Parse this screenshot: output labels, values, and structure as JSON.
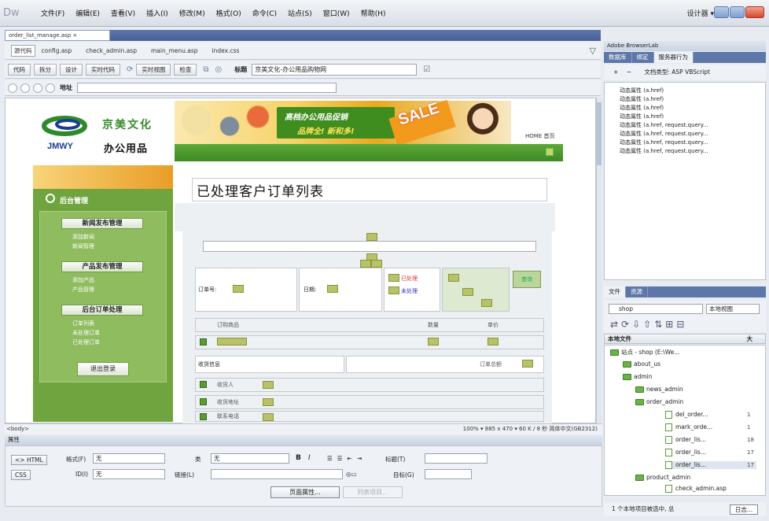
{
  "app": {
    "menus": [
      "文件(F)",
      "编辑(E)",
      "查看(V)",
      "插入(I)",
      "修改(M)",
      "格式(O)",
      "命令(C)",
      "站点(S)",
      "窗口(W)",
      "帮助(H)"
    ],
    "workspace": "设计器 ▾"
  },
  "document": {
    "tab": "order_list_manage.asp ×",
    "related_files": [
      "源代码",
      "config.asp",
      "check_admin.asp",
      "main_menu.asp",
      "index.css"
    ],
    "toolbar": {
      "code": "代码",
      "split": "拆分",
      "design": "设计",
      "live_code": "实时代码",
      "live_view": "实时视图",
      "inspect": "检查",
      "title_label": "标题",
      "title_value": "京美文化-办公用品购物网"
    },
    "address_label": "地址"
  },
  "page": {
    "brand_cn": "京美文化",
    "brand_en": "JMWY",
    "brand_sub": "办公用品",
    "banner_line1": "高档办公用品促销",
    "banner_line2": "品牌全! 新和多!",
    "sale": "SALE",
    "header_side": "HOME 首页",
    "title": "已处理客户订单列表",
    "sidebar": {
      "title": "后台管理",
      "groups": [
        {
          "head": "新闻发布管理",
          "items": [
            "添加新闻",
            "新闻管理"
          ]
        },
        {
          "head": "产品发布管理",
          "items": [
            "添加产品",
            "产品管理"
          ]
        },
        {
          "head": "后台订单处理",
          "items": [
            "订单列表",
            "未处理订单",
            "已处理订单"
          ]
        }
      ],
      "logout": "退出登录"
    },
    "filter": {
      "order_no": "订单号:",
      "date": "日期:",
      "processed": "已处理",
      "unprocessed": "未处理",
      "search": "查询"
    },
    "list_headers": [
      "订购商品",
      "数量",
      "单价"
    ],
    "order_info": "收货信息",
    "order_total": "订单总额",
    "fields": [
      "收货人",
      "收货地址",
      "联系电话"
    ]
  },
  "status": {
    "tag": "<body>",
    "right": "100% ▾  885 x 470 ▾  60 K / 8 秒  简体中文(GB2312)"
  },
  "properties": {
    "title": "属性",
    "html": "<> HTML",
    "css": "CSS",
    "format_label": "格式(F)",
    "format_value": "无",
    "id_label": "ID(I)",
    "id_value": "无",
    "class_label": "类",
    "class_value": "无",
    "link_label": "链接(L)",
    "title_label": "标题(T)",
    "target_label": "目标(G)",
    "page_props": "页面属性...",
    "list_item": "列表项目..."
  },
  "panels": {
    "browserlab": "Adobe BrowserLab",
    "tabs": [
      "数据库",
      "绑定",
      "服务器行为"
    ],
    "doc_type": "文档类型: ASP VBScript",
    "behaviors": [
      "动态属性 (a.href)",
      "动态属性 (a.href)",
      "动态属性 (a.href)",
      "动态属性 (a.href)",
      "动态属性 (a.href, request.query...",
      "动态属性 (a.href, request.query...",
      "动态属性 (a.href, request.query...",
      "动态属性 (a.href, request.query..."
    ],
    "files_tabs": [
      "文件",
      "资源"
    ],
    "site": "shop",
    "view": "本地视图",
    "local_files": "本地文件",
    "size_col": "大",
    "tree": [
      {
        "name": "站点 - shop (E:\\We...",
        "size": ""
      },
      {
        "name": "about_us",
        "size": ""
      },
      {
        "name": "admin",
        "size": ""
      },
      {
        "name": "news_admin",
        "size": ""
      },
      {
        "name": "order_admin",
        "size": ""
      },
      {
        "name": "del_order...",
        "size": "1"
      },
      {
        "name": "mark_orde...",
        "size": "1"
      },
      {
        "name": "order_lis...",
        "size": "18"
      },
      {
        "name": "order_lis...",
        "size": "17"
      },
      {
        "name": "order_lis...",
        "size": "17"
      },
      {
        "name": "product_admin",
        "size": ""
      },
      {
        "name": "check_admin.asp",
        "size": ""
      }
    ],
    "files_status": "1 个本地项目被选中, 总",
    "log": "日志..."
  }
}
